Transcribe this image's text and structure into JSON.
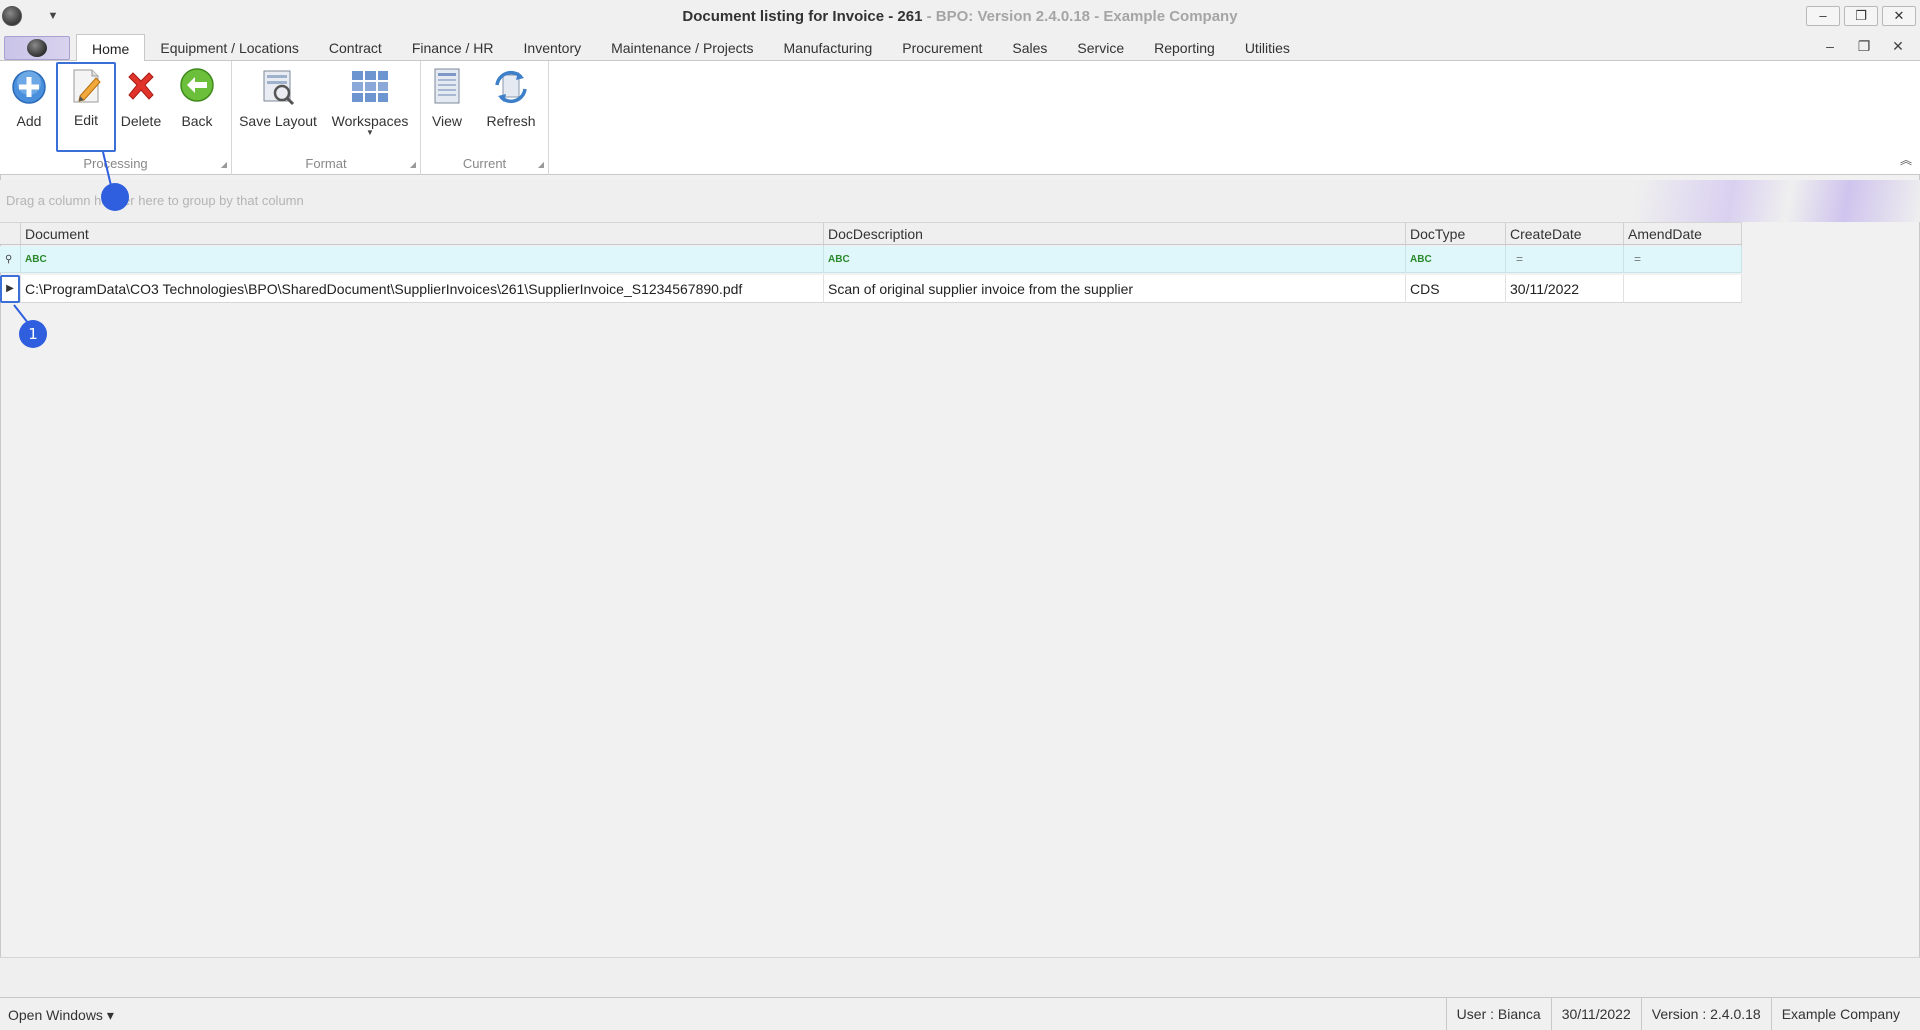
{
  "window": {
    "title_main": "Document listing for Invoice - 261",
    "title_sub": " - BPO: Version 2.4.0.18 - Example Company",
    "minimize": "–",
    "restore": "❐",
    "close": "✕"
  },
  "tabs": [
    {
      "label": "Home"
    },
    {
      "label": "Equipment / Locations"
    },
    {
      "label": "Contract"
    },
    {
      "label": "Finance / HR"
    },
    {
      "label": "Inventory"
    },
    {
      "label": "Maintenance / Projects"
    },
    {
      "label": "Manufacturing"
    },
    {
      "label": "Procurement"
    },
    {
      "label": "Sales"
    },
    {
      "label": "Service"
    },
    {
      "label": "Reporting"
    },
    {
      "label": "Utilities"
    }
  ],
  "ribbon": {
    "groups": {
      "processing": "Processing",
      "format": "Format",
      "current": "Current"
    },
    "buttons": {
      "add": "Add",
      "edit": "Edit",
      "delete": "Delete",
      "back": "Back",
      "save_layout": "Save Layout",
      "workspaces": "Workspaces",
      "view": "View",
      "refresh": "Refresh"
    }
  },
  "group_panel": {
    "hint": "Drag a column header here to group by that column"
  },
  "grid": {
    "columns": [
      "Document",
      "DocDescription",
      "DocType",
      "CreateDate",
      "AmendDate"
    ],
    "filter_abc": "ABC",
    "filter_eq": "=",
    "rows": [
      {
        "document": "C:\\ProgramData\\CO3 Technologies\\BPO\\SharedDocument\\SupplierInvoices\\261\\SupplierInvoice_S1234567890.pdf",
        "description": "Scan of original supplier invoice from the supplier",
        "doctype": "CDS",
        "createdate": "30/11/2022",
        "amenddate": ""
      }
    ]
  },
  "annotations": {
    "badge_1": "1"
  },
  "status": {
    "open_windows": "Open Windows ▾",
    "user": "User : Bianca",
    "date": "30/11/2022",
    "version": "Version : 2.4.0.18",
    "company": "Example Company"
  },
  "colors": {
    "accent": "#3a6fd8",
    "callout": "#2f5fde",
    "filter_row": "#dff6fb"
  }
}
